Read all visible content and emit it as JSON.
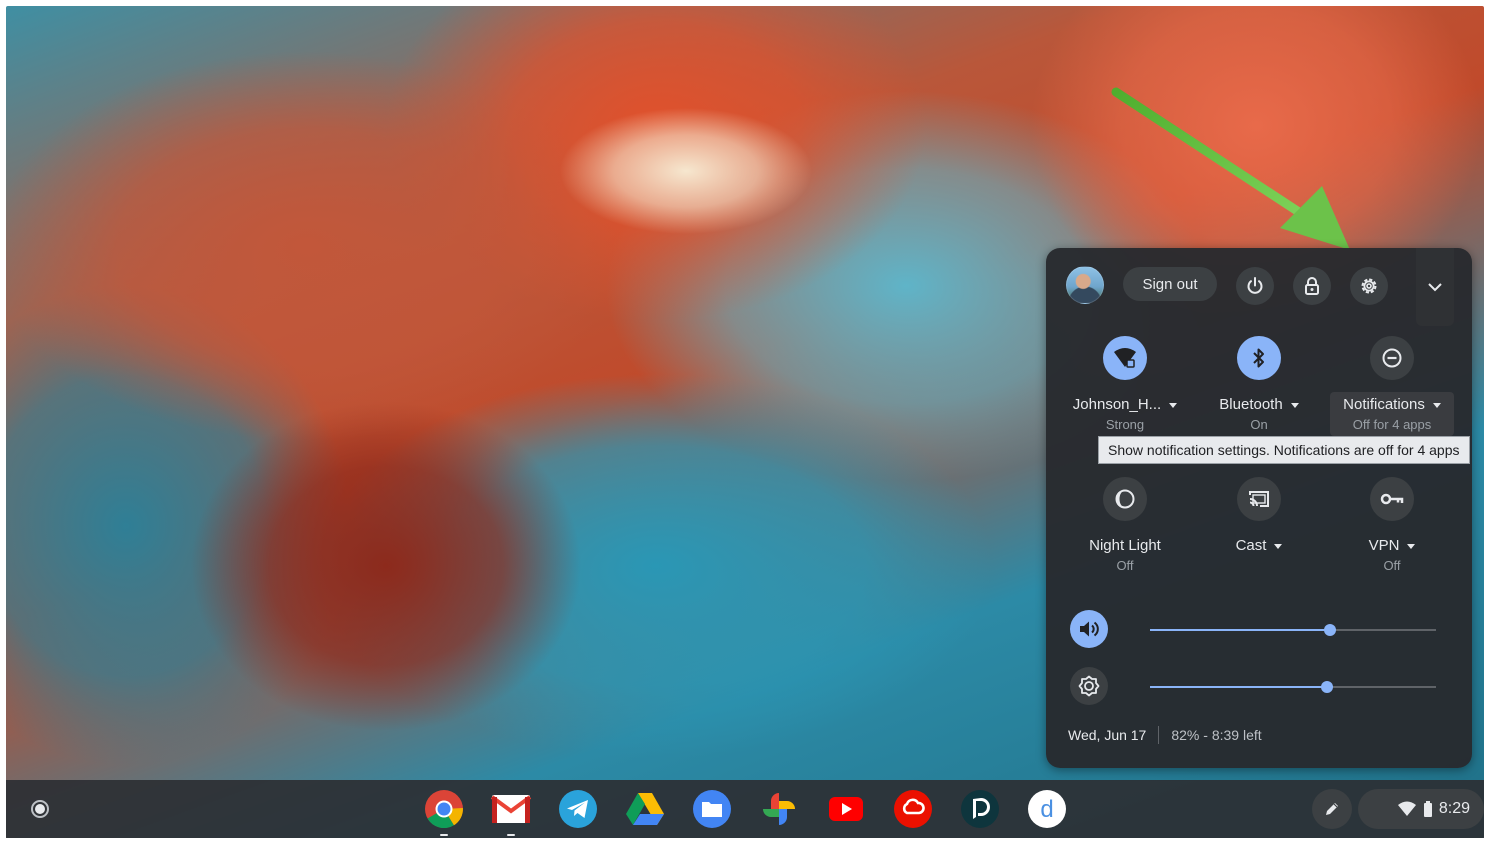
{
  "quick_settings": {
    "sign_out_label": "Sign out",
    "icons": {
      "power": "power-icon",
      "lock": "lock-icon",
      "settings": "gear-icon",
      "collapse": "chevron-down-icon"
    },
    "tiles": [
      {
        "label": "Johnson_H...",
        "sub": "Strong",
        "on": true,
        "icon": "wifi-icon"
      },
      {
        "label": "Bluetooth",
        "sub": "On",
        "on": true,
        "icon": "bluetooth-icon"
      },
      {
        "label": "Notifications",
        "sub": "Off for 4 apps",
        "on": false,
        "icon": "do-not-disturb-icon"
      },
      {
        "label": "Night Light",
        "sub": "Off",
        "on": false,
        "icon": "night-light-icon"
      },
      {
        "label": "Cast",
        "sub": "",
        "on": false,
        "icon": "cast-icon"
      },
      {
        "label": "VPN",
        "sub": "Off",
        "on": false,
        "icon": "vpn-key-icon"
      }
    ],
    "tooltip": "Show notification settings. Notifications are off for 4 apps",
    "volume_level": 0.63,
    "brightness_level": 0.62,
    "date": "Wed, Jun 17",
    "battery": "82% - 8:39 left"
  },
  "shelf": {
    "apps": [
      "Chrome",
      "Gmail",
      "Telegram",
      "Google Drive",
      "Files",
      "Google Photos",
      "YouTube",
      "Adobe Creative Cloud",
      "Dashlane",
      "Dictionary"
    ],
    "time": "8:29"
  },
  "colors": {
    "accent": "#8ab4f8",
    "panel": "#282a2e",
    "arrow": "#6cc24a"
  }
}
